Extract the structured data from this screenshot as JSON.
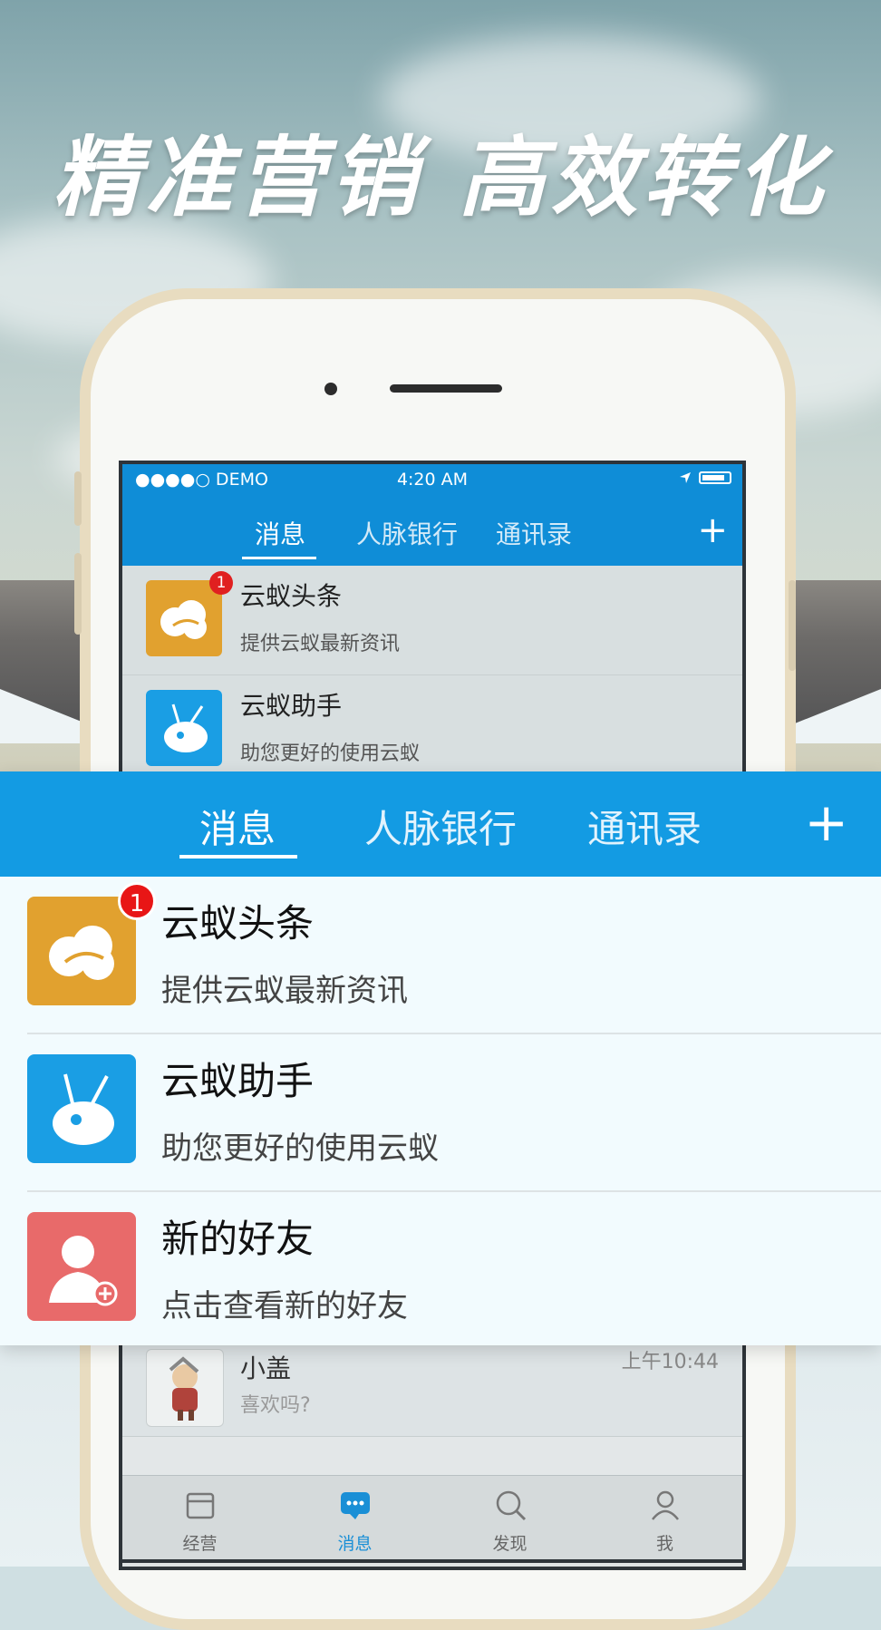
{
  "headline": "精准营销  高效转化",
  "phone_screen": {
    "status": {
      "carrier": "●●●●○ DEMO",
      "time": "4:20 AM"
    },
    "tabs": [
      {
        "label": "消息",
        "active": true
      },
      {
        "label": "人脉银行",
        "active": false
      },
      {
        "label": "通讯录",
        "active": false
      }
    ],
    "add_label": "+",
    "conversations": [
      {
        "title": "云蚁头条",
        "subtitle": "提供云蚁最新资讯",
        "badge": "1",
        "icon": "cloud-icon",
        "icon_color": "#e1a12f"
      },
      {
        "title": "云蚁助手",
        "subtitle": "助您更好的使用云蚁",
        "icon": "ant-icon",
        "icon_color": "#1a9ee4"
      },
      {
        "title": "小盖",
        "subtitle": "喜欢吗?",
        "time": "上午10:44",
        "icon": "avatar-icon"
      }
    ],
    "tabbar": [
      {
        "label": "经营",
        "icon": "store-icon",
        "active": false
      },
      {
        "label": "消息",
        "icon": "chat-icon",
        "active": true
      },
      {
        "label": "发现",
        "icon": "search-icon",
        "active": false
      },
      {
        "label": "我",
        "icon": "person-icon",
        "active": false
      }
    ]
  },
  "zoom": {
    "tabs": [
      {
        "label": "消息",
        "active": true
      },
      {
        "label": "人脉银行",
        "active": false
      },
      {
        "label": "通讯录",
        "active": false
      }
    ],
    "add_label": "+",
    "items": [
      {
        "title": "云蚁头条",
        "subtitle": "提供云蚁最新资讯",
        "badge": "1",
        "icon": "cloud-icon",
        "icon_color": "#e1a12f"
      },
      {
        "title": "云蚁助手",
        "subtitle": "助您更好的使用云蚁",
        "icon": "ant-icon",
        "icon_color": "#1a9ee4"
      },
      {
        "title": "新的好友",
        "subtitle": "点击查看新的好友",
        "icon": "add-friend-icon",
        "icon_color": "#e86a6a"
      }
    ]
  },
  "colors": {
    "primary_blue": "#139be3",
    "badge_red": "#e81616"
  }
}
